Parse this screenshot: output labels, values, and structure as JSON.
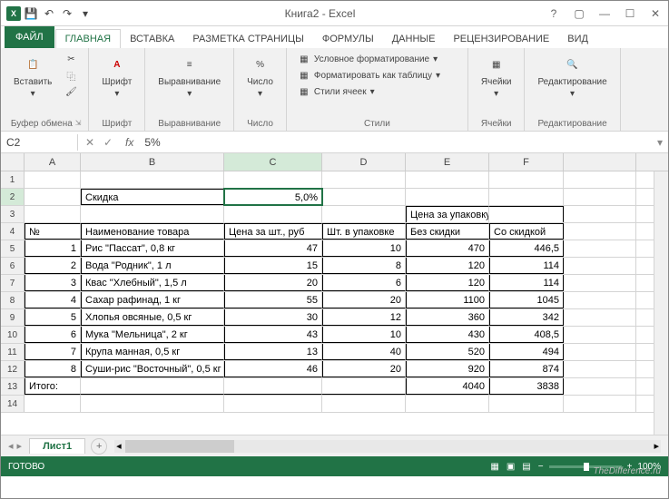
{
  "app": {
    "title": "Книга2 - Excel"
  },
  "tabs": {
    "file": "ФАЙЛ",
    "items": [
      "ГЛАВНАЯ",
      "ВСТАВКА",
      "РАЗМЕТКА СТРАНИЦЫ",
      "ФОРМУЛЫ",
      "ДАННЫЕ",
      "РЕЦЕНЗИРОВАНИЕ",
      "ВИД"
    ],
    "active": 0
  },
  "ribbon": {
    "clipboard": {
      "paste": "Вставить",
      "label": "Буфер обмена"
    },
    "font": {
      "btn": "Шрифт",
      "label": "Шрифт"
    },
    "align": {
      "btn": "Выравнивание",
      "label": "Выравнивание"
    },
    "number": {
      "btn": "Число",
      "label": "Число"
    },
    "styles": {
      "cond": "Условное форматирование",
      "table": "Форматировать как таблицу",
      "cell": "Стили ячеек",
      "label": "Стили"
    },
    "cells": {
      "btn": "Ячейки",
      "label": "Ячейки"
    },
    "editing": {
      "btn": "Редактирование",
      "label": "Редактирование"
    }
  },
  "formula": {
    "ref": "C2",
    "value": "5%"
  },
  "columns": [
    "A",
    "B",
    "C",
    "D",
    "E",
    "F"
  ],
  "sheet": {
    "r2": {
      "b": "Скидка",
      "c": "5,0%"
    },
    "r3": {
      "e": "Цена за упаковку, руб"
    },
    "r4": {
      "a": "№",
      "b": "Наименование товара",
      "c": "Цена за шт., руб",
      "d": "Шт. в упаковке",
      "e": "Без скидки",
      "f": "Со скидкой"
    },
    "data": [
      {
        "n": "1",
        "name": "Рис \"Пассат\", 0,8 кг",
        "price": "47",
        "qty": "10",
        "full": "470",
        "disc": "446,5"
      },
      {
        "n": "2",
        "name": "Вода \"Родник\", 1 л",
        "price": "15",
        "qty": "8",
        "full": "120",
        "disc": "114"
      },
      {
        "n": "3",
        "name": "Квас \"Хлебный\", 1,5 л",
        "price": "20",
        "qty": "6",
        "full": "120",
        "disc": "114"
      },
      {
        "n": "4",
        "name": "Сахар рафинад, 1 кг",
        "price": "55",
        "qty": "20",
        "full": "1100",
        "disc": "1045"
      },
      {
        "n": "5",
        "name": "Хлопья овсяные, 0,5 кг",
        "price": "30",
        "qty": "12",
        "full": "360",
        "disc": "342"
      },
      {
        "n": "6",
        "name": "Мука \"Мельница\", 2 кг",
        "price": "43",
        "qty": "10",
        "full": "430",
        "disc": "408,5"
      },
      {
        "n": "7",
        "name": "Крупа манная, 0,5 кг",
        "price": "13",
        "qty": "40",
        "full": "520",
        "disc": "494"
      },
      {
        "n": "8",
        "name": "Суши-рис \"Восточный\", 0,5 кг",
        "price": "46",
        "qty": "20",
        "full": "920",
        "disc": "874"
      }
    ],
    "total": {
      "label": "Итого:",
      "full": "4040",
      "disc": "3838"
    }
  },
  "sheettab": "Лист1",
  "status": {
    "ready": "ГОТОВО",
    "zoom": "100%"
  },
  "watermark": "TheDifference.ru"
}
